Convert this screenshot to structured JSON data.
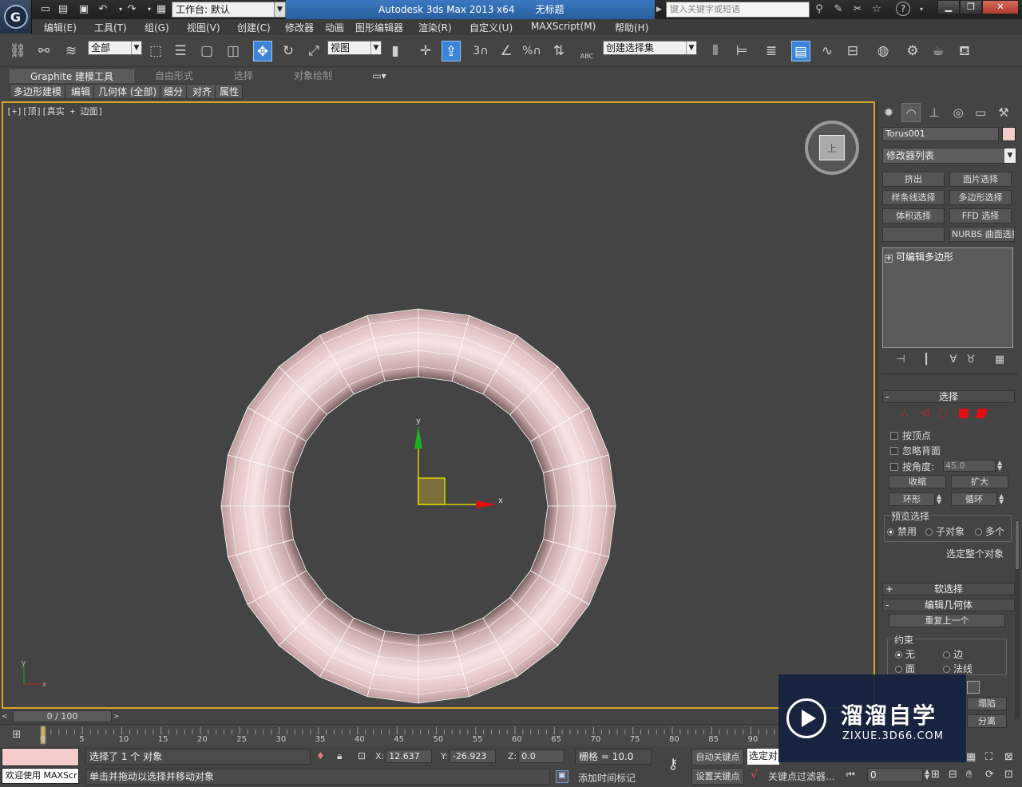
{
  "title_bar": {
    "workspace": "工作台: 默认",
    "app_name": "Autodesk 3ds Max  2013 x64",
    "doc_name": "无标题",
    "search_placeholder": "键入关键字或短语",
    "help": "?"
  },
  "menu": [
    "编辑(E)",
    "工具(T)",
    "组(G)",
    "视图(V)",
    "创建(C)",
    "修改器",
    "动画",
    "图形编辑器",
    "渲染(R)",
    "自定义(U)",
    "MAXScript(M)",
    "帮助(H)"
  ],
  "toolbar": {
    "filter": "全部",
    "ref_coord": "视图",
    "named_sel": "创建选择集",
    "snap_3": "3",
    "percent": "%",
    "abc": "ABC"
  },
  "ribbon": {
    "tabs": [
      "Graphite 建模工具",
      "自由形式",
      "选择",
      "对象绘制"
    ],
    "subtabs": [
      "多边形建模",
      "编辑",
      "几何体 (全部)",
      "细分",
      "对齐",
      "属性"
    ]
  },
  "viewport": {
    "label": "[+][顶][真实 + 边面]",
    "cube_face": "上",
    "axis_x": "x",
    "axis_y": "y"
  },
  "panel": {
    "object_name": "Torus001",
    "object_color": "#f5cccc",
    "modifier_list": "修改器列表",
    "modifier_buttons": [
      "挤出",
      "面片选择",
      "样条线选择",
      "多边形选择",
      "体积选择",
      "FFD 选择",
      "",
      "NURBS 曲面选择"
    ],
    "stack_item": "可编辑多边形",
    "rollout_selection": "选择",
    "by_vertex": "按顶点",
    "ignore_back": "忽略背面",
    "by_angle": "按角度:",
    "angle_value": "45.0",
    "shrink": "收缩",
    "grow": "扩大",
    "ring": "环形",
    "loop": "循环",
    "preview_group": "预览选择",
    "preview_opts": [
      "禁用",
      "子对象",
      "多个"
    ],
    "whole_object": "选定整个对象",
    "soft_sel": "软选择",
    "edit_geom": "编辑几何体",
    "repeat_last": "重复上一个",
    "constraint": "约束",
    "constraint_opts": [
      "无",
      "边",
      "面",
      "法线"
    ],
    "collapse": "塌陷",
    "detach": "分离"
  },
  "timeline": {
    "frame": "0 / 100",
    "ticks": [
      "0",
      "5",
      "10",
      "15",
      "20",
      "25",
      "30",
      "35",
      "40",
      "45",
      "50",
      "55",
      "60",
      "65",
      "70",
      "75",
      "80",
      "85",
      "90"
    ]
  },
  "status": {
    "welcome": "欢迎使用 MAXScr",
    "selected": "选择了 1 个 对象",
    "prompt": "单击并拖动以选择并移动对象",
    "x": "12.637",
    "y": "-26.923",
    "z": "0.0",
    "grid": "栅格 = 10.0",
    "auto_key": "自动关键点",
    "set_key": "设置关键点",
    "sel_obj": "选定对",
    "add_tag": "添加时间标记",
    "key_filter": "关键点过滤器...",
    "frame_value": "0"
  },
  "watermark": {
    "title": "溜溜自学",
    "sub": "ZIXUE.3D66.COM"
  }
}
